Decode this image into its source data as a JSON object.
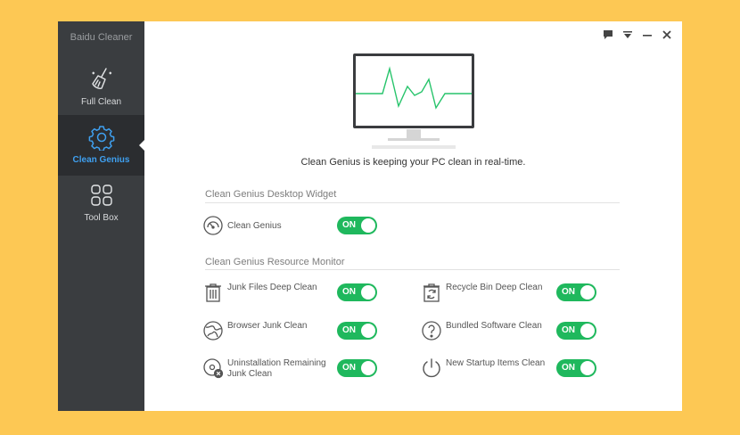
{
  "app": {
    "title": "Baidu Cleaner"
  },
  "sidebar": {
    "items": [
      {
        "label": "Full Clean",
        "icon": "broom-icon"
      },
      {
        "label": "Clean Genius",
        "icon": "gear-icon",
        "active": true
      },
      {
        "label": "Tool Box",
        "icon": "grid-icon"
      }
    ]
  },
  "window_controls": [
    "feedback-icon",
    "menu-icon",
    "minimize-icon",
    "close-icon"
  ],
  "main": {
    "tagline": "Clean Genius is keeping your PC clean in real-time.",
    "sections": [
      {
        "title": "Clean Genius Desktop Widget",
        "items": [
          {
            "label": "Clean Genius",
            "toggle": "ON",
            "icon": "gauge-icon"
          }
        ]
      },
      {
        "title": "Clean Genius Resource Monitor",
        "items": [
          {
            "label": "Junk Files Deep Clean",
            "toggle": "ON",
            "icon": "trash-icon"
          },
          {
            "label": "Recycle Bin Deep Clean",
            "toggle": "ON",
            "icon": "recycle-bin-icon"
          },
          {
            "label": "Browser Junk Clean",
            "toggle": "ON",
            "icon": "globe-icon"
          },
          {
            "label": "Bundled Software Clean",
            "toggle": "ON",
            "icon": "question-icon"
          },
          {
            "label": "Uninstallation Remaining Junk Clean",
            "toggle": "ON",
            "icon": "disc-remove-icon"
          },
          {
            "label": "New Startup Items Clean",
            "toggle": "ON",
            "icon": "power-icon"
          }
        ]
      }
    ]
  },
  "colors": {
    "accent": "#3fa0f0",
    "toggle_on": "#1fb85d",
    "sidebar": "#3a3d40",
    "background": "#fdc854",
    "pulse": "#27c46b"
  }
}
